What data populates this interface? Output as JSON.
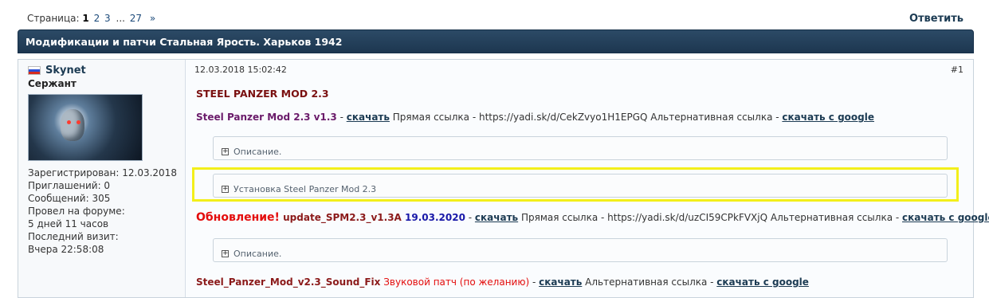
{
  "pagination": {
    "label": "Страница:",
    "current": "1",
    "pages": [
      "2",
      "3"
    ],
    "ellipsis": "...",
    "last": "27",
    "next": "»"
  },
  "reply_label": "Ответить",
  "topic_title": "Модификации и патчи Стальная Ярость. Харьков 1942",
  "author": {
    "name": "Skynet",
    "rank": "Сержант",
    "stats": [
      "Зарегистрирован: 12.03.2018",
      "Приглашений: 0",
      "Сообщений: 305",
      "Провел на форуме:",
      "5 дней 11 часов",
      "Последний визит:",
      "Вчера 22:58:08"
    ]
  },
  "post": {
    "date": "12.03.2018 15:02:42",
    "number": "#1",
    "title": "STEEL PANZER MOD 2.3",
    "line1": {
      "name": "Steel Panzer Mod 2.3 v1.3",
      "sep": " - ",
      "download": "скачать",
      "direct": " Прямая ссылка - https://yadi.sk/d/CekZvyo1H1EPGQ Альтернативная ссылка - ",
      "google": "скачать с google"
    },
    "spoiler1": "Описание.",
    "spoiler2": "Установка Steel Panzer Mod 2.3",
    "line2": {
      "update": "Обновление!",
      "file": " update_SPM2.3_v1.3A",
      "date": " 19.03.2020",
      "sep": " - ",
      "download": "скачать",
      "direct": " Прямая ссылка - https://yadi.sk/d/uzCI59CPkFVXjQ Альтернативная ссылка - ",
      "google": "скачать с google"
    },
    "spoiler3": "Описание.",
    "line3": {
      "file": "Steel_Panzer_Mod_v2.3_Sound_Fix",
      "note": " Звуковой патч (по желанию)",
      "sep": " - ",
      "download": "скачать",
      "alt": " Альтернативная ссылка - ",
      "google": "скачать с google"
    }
  }
}
